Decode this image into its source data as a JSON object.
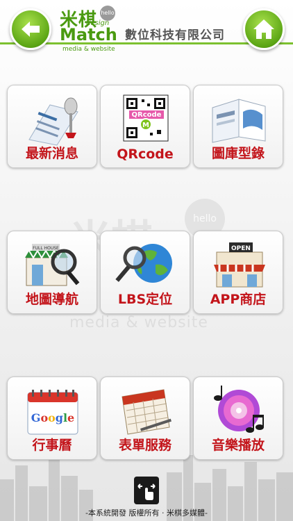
{
  "header": {
    "logo_mi": "米棋",
    "logo_design": "design",
    "logo_hello": "hello",
    "logo_match": "Match",
    "logo_tagline": "media & website",
    "company_name": "數位科技有限公司",
    "back_icon": "back-arrow-icon",
    "home_icon": "home-icon"
  },
  "watermark": {
    "text": "米棋",
    "hello": "hello",
    "sub": "media & website"
  },
  "tiles": [
    {
      "label": "最新消息",
      "icon": "news-microphone-icon"
    },
    {
      "label": "QRcode",
      "icon": "qrcode-icon"
    },
    {
      "label": "圖庫型錄",
      "icon": "catalog-book-icon"
    },
    {
      "label": "地圖導航",
      "icon": "map-search-shop-icon"
    },
    {
      "label": "LBS定位",
      "icon": "globe-magnifier-icon"
    },
    {
      "label": "APP商店",
      "icon": "app-store-shop-icon"
    },
    {
      "label": "行事曆",
      "icon": "google-calendar-icon"
    },
    {
      "label": "表單服務",
      "icon": "form-calendar-icon"
    },
    {
      "label": "音樂播放",
      "icon": "music-disc-icon"
    }
  ],
  "footer": {
    "text": "-本系統開發 版權所有 · 米棋多媒體-",
    "nav_icon": "swipe-nav-icon"
  },
  "colors": {
    "accent_green": "#5ca615",
    "label_red": "#c3151b"
  }
}
